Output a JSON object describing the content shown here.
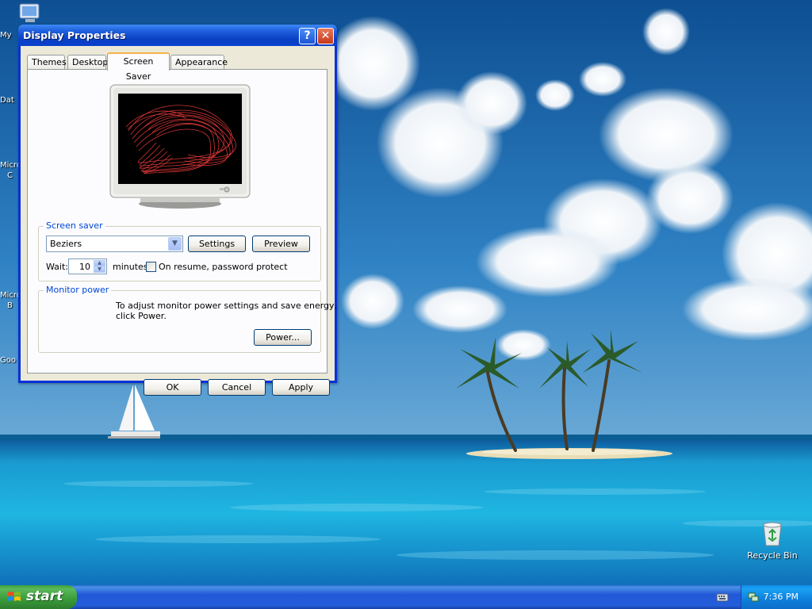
{
  "window": {
    "title": "Display Properties",
    "help_button": "?",
    "close_button": "✕"
  },
  "tabs": [
    {
      "label": "Themes"
    },
    {
      "label": "Desktop"
    },
    {
      "label": "Screen Saver"
    },
    {
      "label": "Appearance"
    }
  ],
  "screen_saver": {
    "group_title": "Screen saver",
    "selected": "Beziers",
    "settings_label": "Settings",
    "preview_label": "Preview",
    "wait_label": "Wait:",
    "wait_value": "10",
    "minutes_label": "minutes",
    "password_label": "On resume, password protect",
    "password_checked": false
  },
  "monitor_power": {
    "group_title": "Monitor power",
    "description_line1": "To adjust monitor power settings and save energy,",
    "description_line2": "click Power.",
    "power_label": "Power..."
  },
  "dialog_buttons": {
    "ok": "OK",
    "cancel": "Cancel",
    "apply": "Apply"
  },
  "desktop": {
    "partial_labels": [
      "My",
      "Dat",
      "Micro",
      "C",
      "Micro",
      "B",
      "Goo"
    ],
    "recycle_bin": "Recycle Bin"
  },
  "taskbar": {
    "start_label": "start",
    "clock": "7:36 PM"
  },
  "icons": {
    "help": "help-icon",
    "close": "close-icon",
    "dropdown": "chevron-down-icon",
    "spin_up": "spin-up-icon",
    "spin_down": "spin-down-icon",
    "recycle_bin": "recycle-bin-icon",
    "start_logo": "windows-logo-icon",
    "keyboard": "keyboard-icon",
    "network": "network-tray-icon"
  },
  "colors": {
    "title_bar": "#0a3fc4",
    "dialog_face": "#ece9d8",
    "group_title": "#0046d5",
    "active_tab_accent": "#f7b24a",
    "start_button": "#3a9b3a",
    "taskbar": "#245edb",
    "screen_saver_curve": "#e83a3a"
  }
}
